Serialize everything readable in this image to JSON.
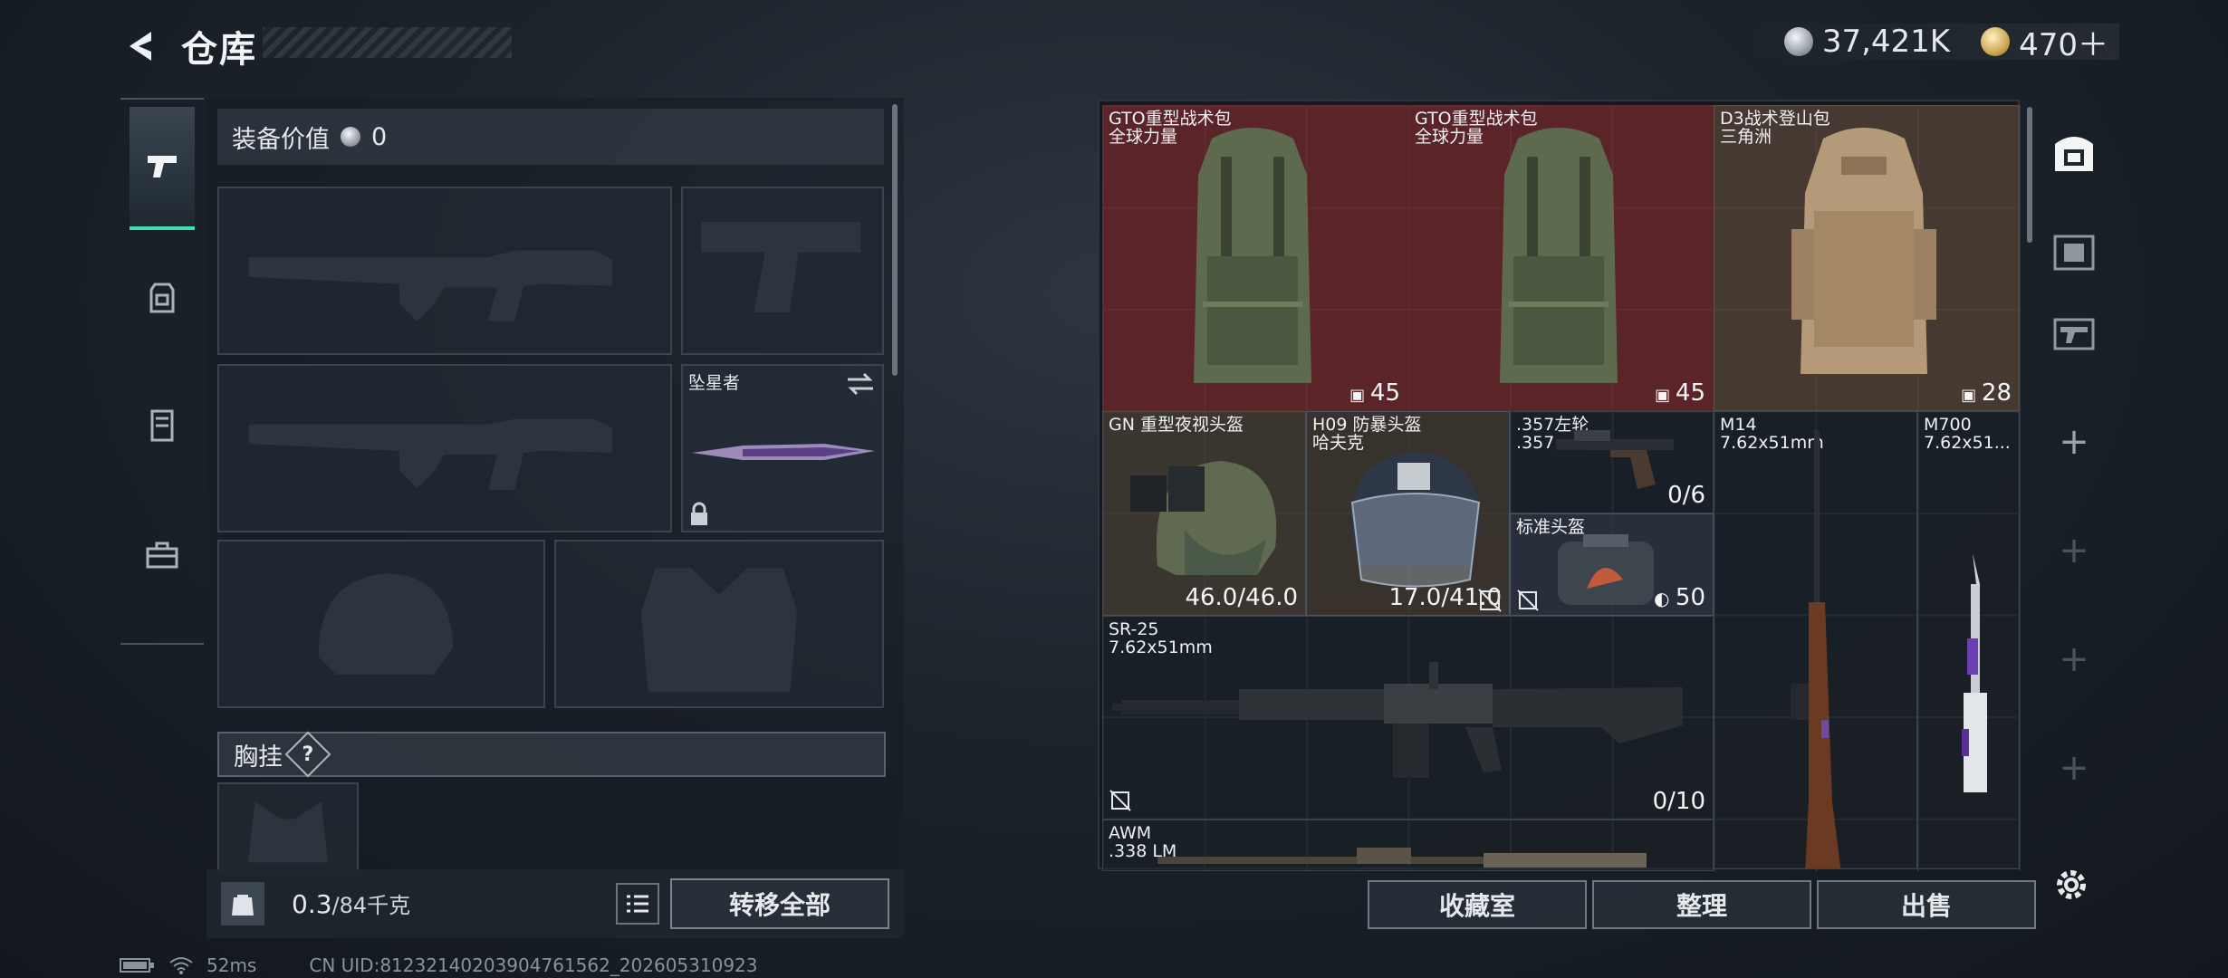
{
  "header": {
    "title": "仓库"
  },
  "currency": {
    "silver": "37,421K",
    "gold": "470＋"
  },
  "left_tabs": [
    {
      "name": "weapons",
      "active": true
    },
    {
      "name": "backpack",
      "active": false
    },
    {
      "name": "armor",
      "active": false
    },
    {
      "name": "tools",
      "active": false
    }
  ],
  "equipment": {
    "value_label": "装备价值",
    "value": "0",
    "melee_label": "坠星者",
    "chest_label": "胸挂",
    "help_label": "?"
  },
  "weight": {
    "current": "0.3",
    "max": "/84千克"
  },
  "buttons": {
    "transfer_all": "转移全部",
    "collection": "收藏室",
    "organize": "整理",
    "sell": "出售"
  },
  "stash_items": [
    {
      "name": "GTO重型战术包",
      "sub": "全球力量",
      "value": "45"
    },
    {
      "name": "GTO重型战术包",
      "sub": "全球力量",
      "value": "45"
    },
    {
      "name": "D3战术登山包",
      "sub": "三角洲",
      "value": "28"
    },
    {
      "name": "GN 重型夜视头盔",
      "sub": "",
      "value": "46.0/46.0"
    },
    {
      "name": "H09 防暴头盔",
      "sub": "哈夫克",
      "value": "17.0/41.0"
    },
    {
      "name": ".357左轮",
      "sub": ".357",
      "value": "0/6"
    },
    {
      "name": "标准头盔",
      "sub": "",
      "value": "50"
    },
    {
      "name": "M14",
      "sub": "7.62x51mm",
      "value": ""
    },
    {
      "name": "M700",
      "sub": "7.62x51...",
      "value": ""
    },
    {
      "name": "SR-25",
      "sub": "7.62x51mm",
      "value": "0/10"
    },
    {
      "name": "AWM",
      "sub": ".338 LM",
      "value": ""
    }
  ],
  "status": {
    "ping": "52ms",
    "uid": "CN UID:8123214020390476156​2_202605310923"
  }
}
